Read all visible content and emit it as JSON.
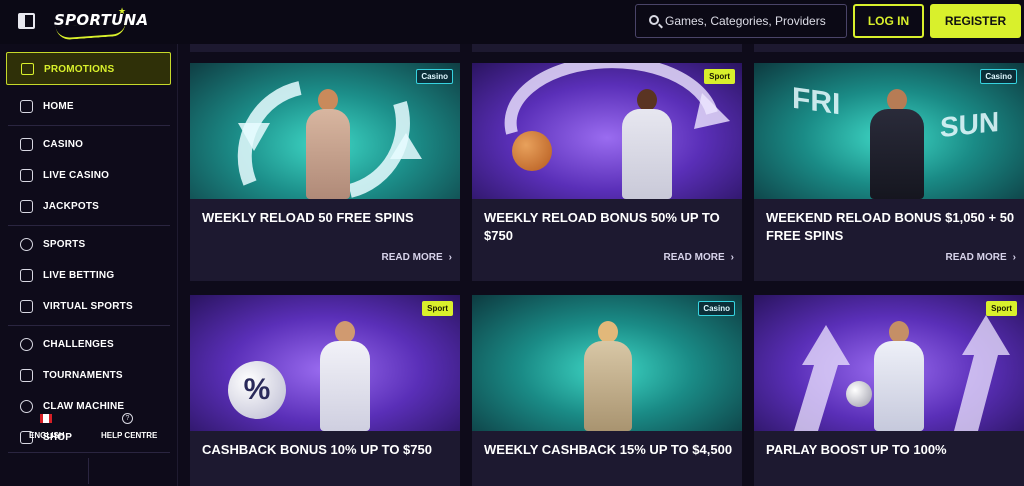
{
  "header": {
    "logo_text": "SPORTUNA",
    "search_placeholder": "Games, Categories, Providers",
    "login_label": "LOG IN",
    "register_label": "REGISTER"
  },
  "sidebar": {
    "promotions": "PROMOTIONS",
    "items": [
      {
        "label": "HOME",
        "icon": "home-icon"
      },
      {
        "label": "CASINO",
        "icon": "casino-icon"
      },
      {
        "label": "LIVE CASINO",
        "icon": "live-casino-icon"
      },
      {
        "label": "JACKPOTS",
        "icon": "jackpots-icon"
      },
      {
        "label": "SPORTS",
        "icon": "sports-icon"
      },
      {
        "label": "LIVE BETTING",
        "icon": "live-betting-icon"
      },
      {
        "label": "VIRTUAL SPORTS",
        "icon": "gamepad-icon"
      },
      {
        "label": "CHALLENGES",
        "icon": "challenges-icon"
      },
      {
        "label": "TOURNAMENTS",
        "icon": "tournaments-icon"
      },
      {
        "label": "CLAW MACHINE",
        "icon": "claw-icon"
      },
      {
        "label": "SHOP",
        "icon": "shop-icon"
      }
    ],
    "footer": {
      "language": "ENGLISH",
      "help": "HELP CENTRE"
    }
  },
  "promotions": [
    {
      "title": "WEEKLY RELOAD 50 FREE SPINS",
      "badge": "Casino",
      "read_more": "READ MORE"
    },
    {
      "title": "WEEKLY RELOAD BONUS 50% UP TO $750",
      "badge": "Sport",
      "read_more": "READ MORE"
    },
    {
      "title": "WEEKEND RELOAD BONUS $1,050 + 50 FREE SPINS",
      "badge": "Casino",
      "read_more": "READ MORE",
      "image_text_1": "FRI",
      "image_text_2": "SUN"
    },
    {
      "title": "CASHBACK BONUS 10% UP TO $750",
      "badge": "Sport",
      "image_text": "%"
    },
    {
      "title": "WEEKLY CASHBACK 15% UP TO $4,500",
      "badge": "Casino"
    },
    {
      "title": "PARLAY BOOST UP TO 100%",
      "badge": "Sport"
    }
  ],
  "colors": {
    "accent": "#d9f02c",
    "background": "#0e0b1a",
    "card": "#1d1930",
    "casino_badge": "#36d3e0"
  }
}
